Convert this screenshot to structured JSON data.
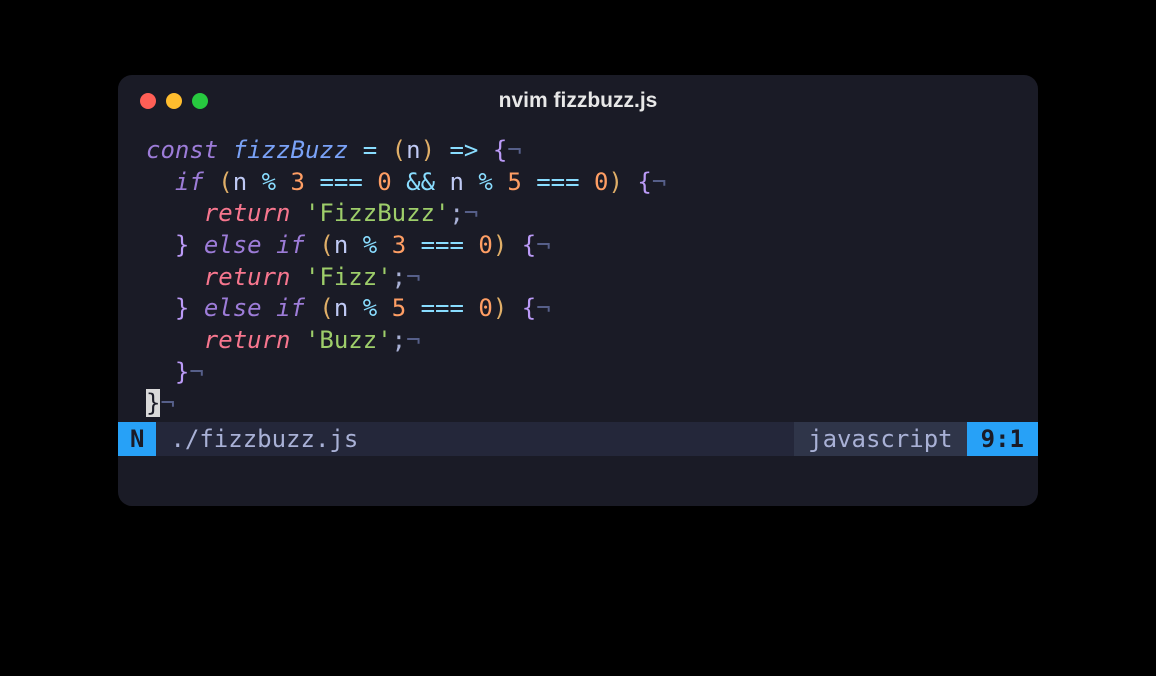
{
  "title": "nvim fizzbuzz.js",
  "eol_char": "¬",
  "code": {
    "l1": {
      "kw": "const",
      "fn": "fizzBuzz",
      "eq": "=",
      "paren_o": "(",
      "param": "n",
      "paren_c": ")",
      "arrow": "=>",
      "brace_o": "{"
    },
    "l2": {
      "kw": "if",
      "paren_o": "(",
      "v1": "n",
      "mod1": "%",
      "n1": "3",
      "eqop1": "===",
      "z1": "0",
      "and": "&&",
      "v2": "n",
      "mod2": "%",
      "n2": "5",
      "eqop2": "===",
      "z2": "0",
      "paren_c": ")",
      "brace_o": "{"
    },
    "l3": {
      "kw": "return",
      "q1": "'",
      "str": "FizzBuzz",
      "q2": "'",
      "semi": ";"
    },
    "l4": {
      "brace_c": "}",
      "else": "else",
      "if2": "if",
      "paren_o": "(",
      "v": "n",
      "mod": "%",
      "n": "3",
      "eqop": "===",
      "z": "0",
      "paren_c": ")",
      "brace_o": "{"
    },
    "l5": {
      "kw": "return",
      "q1": "'",
      "str": "Fizz",
      "q2": "'",
      "semi": ";"
    },
    "l6": {
      "brace_c": "}",
      "else": "else",
      "if2": "if",
      "paren_o": "(",
      "v": "n",
      "mod": "%",
      "n": "5",
      "eqop": "===",
      "z": "0",
      "paren_c": ")",
      "brace_o": "{"
    },
    "l7": {
      "kw": "return",
      "q1": "'",
      "str": "Buzz",
      "q2": "'",
      "semi": ";"
    },
    "l8": {
      "brace_c": "}"
    },
    "l9": {
      "brace_c": "}"
    }
  },
  "statusline": {
    "mode": "N",
    "filename": "./fizzbuzz.js",
    "filetype": "javascript",
    "position": "9:1"
  }
}
